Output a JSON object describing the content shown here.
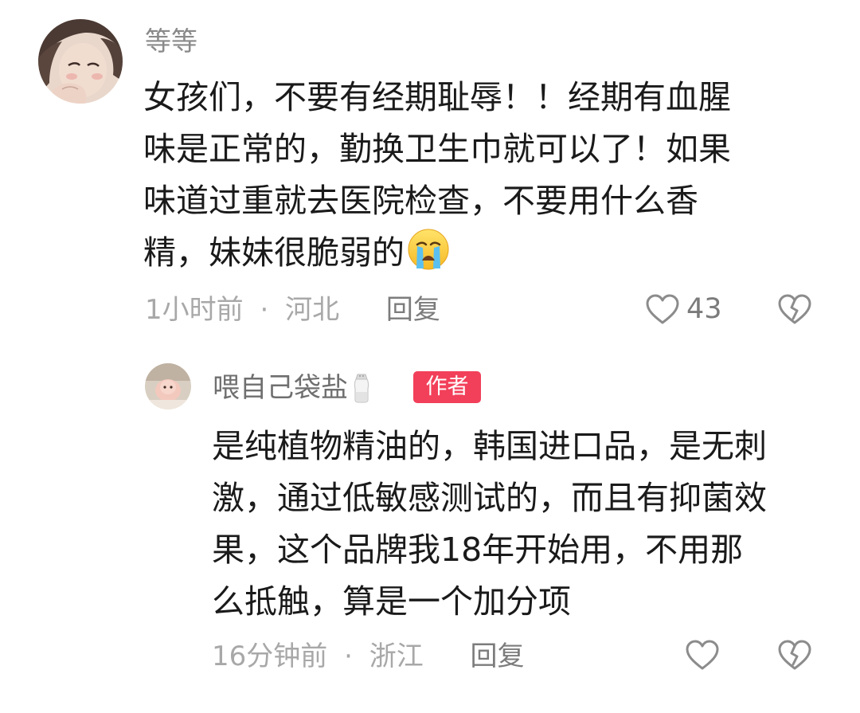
{
  "comments": [
    {
      "username": "等等",
      "body_lines": [
        "女孩们，不要有经期耻辱！！经期有血腥",
        "味是正常的，勤换卫生巾就可以了！如果",
        "味道过重就去医院检查，不要用什么香",
        "精，妹妹很脆弱的"
      ],
      "emoji": "crying-face",
      "time": "1小时前",
      "separator": "·",
      "location": "河北",
      "reply_label": "回复",
      "like_count": "43"
    },
    {
      "username": "喂自己袋盐",
      "badge": "作者",
      "body_lines": [
        "是纯植物精油的，韩国进口品，是无刺",
        "激，通过低敏感测试的，而且有抑菌效",
        "果，这个品牌我18年开始用，不用那",
        "么抵触，算是一个加分项"
      ],
      "time": "16分钟前",
      "separator": "·",
      "location": "浙江",
      "reply_label": "回复",
      "like_count": ""
    }
  ],
  "icons": {
    "like": "heart-outline-icon",
    "dislike": "broken-heart-icon",
    "salt": "salt-shaker-icon"
  },
  "colors": {
    "badge": "#f2405a",
    "meta_text": "#a8a8a8",
    "username": "#8a8a8a",
    "body_text": "#1a1a1a"
  }
}
